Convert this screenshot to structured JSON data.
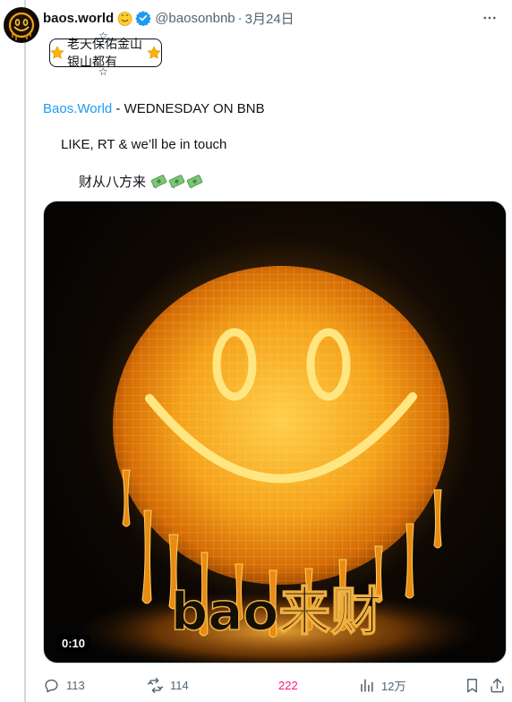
{
  "tweet": {
    "display_name": "baos.world",
    "handle": "@baosonbnb",
    "separator": "·",
    "date": "3月24日",
    "banner_text": "老天保佑金山银山都有",
    "line1_link": "Baos.World",
    "line1_rest": " - WEDNESDAY ON BNB",
    "line2": "LIKE, RT & we’ll be in touch",
    "line3": "财从八方来",
    "media": {
      "duration": "0:10",
      "overlay_text": "bao来财"
    },
    "actions": {
      "replies": "113",
      "retweets": "114",
      "likes": "222",
      "views": "12万"
    },
    "colors": {
      "link": "#1d9bf0",
      "like_active": "#f91880",
      "verified": "#1d9bf0"
    },
    "icons": [
      "emoji-face-icon",
      "verified-badge-icon",
      "more-icon",
      "star-emoji-icon",
      "money-emoji-icon",
      "reply-icon",
      "retweet-icon",
      "like-icon",
      "views-icon",
      "bookmark-icon",
      "share-icon"
    ]
  }
}
